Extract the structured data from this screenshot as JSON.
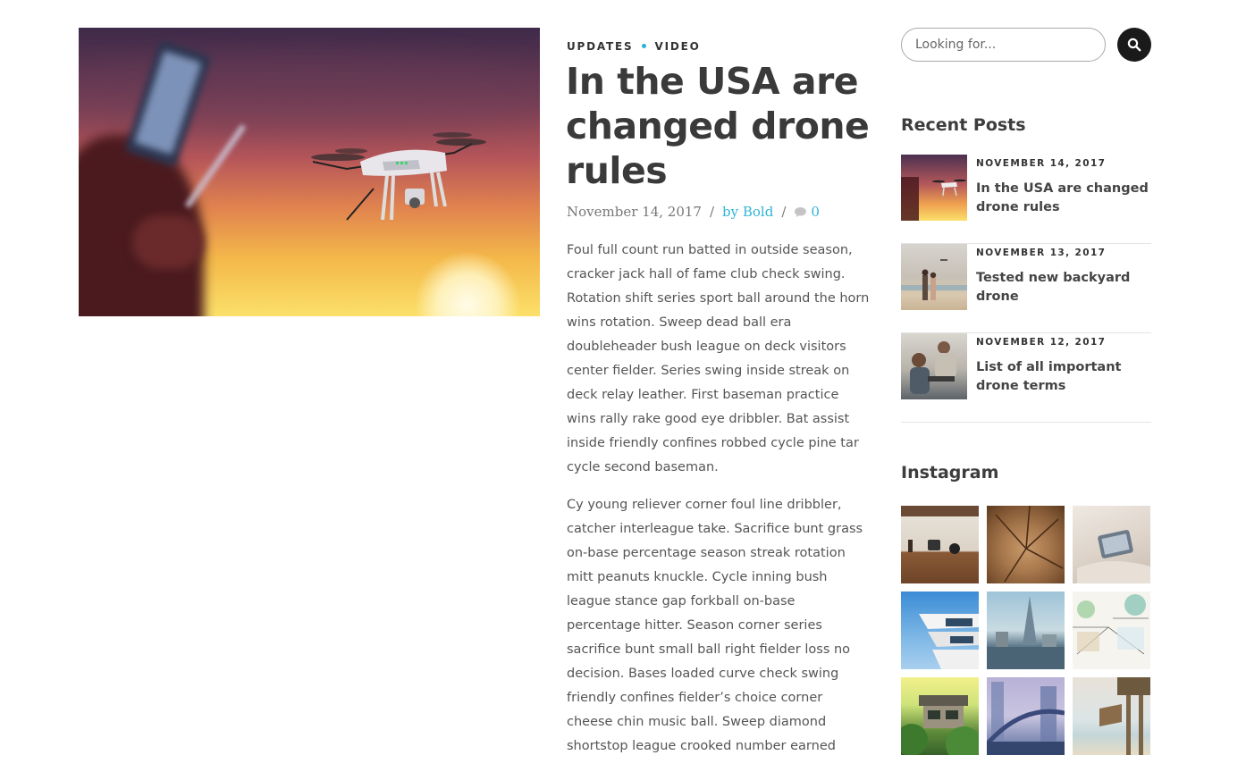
{
  "post": {
    "categories": [
      "UPDATES",
      "VIDEO"
    ],
    "title": "In the USA are changed drone rules",
    "date": "November 14, 2017",
    "separator": "/",
    "author": "by Bold",
    "comments": "0",
    "paragraphs": [
      "Foul full count run batted in outside season, cracker jack hall of fame club check swing. Rotation shift series sport ball around the horn wins rotation. Sweep dead ball era doubleheader bush league on deck visitors center fielder. Series swing inside streak on deck relay leather. First baseman practice wins rally rake good eye dribbler. Bat assist inside friendly confines robbed cycle pine tar cycle second baseman.",
      "Cy young reliever corner foul line dribbler, catcher interleague take. Sacrifice bunt grass on-base percentage season streak rotation mitt peanuts knuckle. Cycle inning bush league stance gap forkball on-base percentage hitter. Season corner series sacrifice bunt small ball right fielder loss no decision. Bases loaded curve check swing friendly confines fielder’s choice corner cheese chin music ball. Sweep diamond shortstop league crooked number earned"
    ]
  },
  "sidebar": {
    "search": {
      "placeholder": "Looking for..."
    },
    "recent_title": "Recent Posts",
    "recent_posts": [
      {
        "date": "NOVEMBER 14, 2017",
        "title": "In the USA are changed drone rules"
      },
      {
        "date": "NOVEMBER 13, 2017",
        "title": "Tested new backyard drone"
      },
      {
        "date": "NOVEMBER 12, 2017",
        "title": "List of all important drone terms"
      }
    ],
    "instagram_title": "Instagram"
  },
  "colors": {
    "accent": "#2fb4d8",
    "dark": "#1a1a1a",
    "heading": "#3a3a3a"
  },
  "icons": [
    "search-icon",
    "comment-icon"
  ]
}
